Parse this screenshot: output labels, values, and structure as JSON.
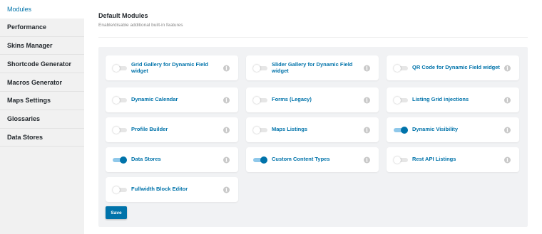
{
  "sidebar": {
    "items": [
      {
        "label": "Modules",
        "active": true
      },
      {
        "label": "Performance",
        "active": false
      },
      {
        "label": "Skins Manager",
        "active": false
      },
      {
        "label": "Shortcode Generator",
        "active": false
      },
      {
        "label": "Macros Generator",
        "active": false
      },
      {
        "label": "Maps Settings",
        "active": false
      },
      {
        "label": "Glossaries",
        "active": false
      },
      {
        "label": "Data Stores",
        "active": false
      }
    ]
  },
  "main": {
    "title": "Default Modules",
    "subtitle": "Enable/disable additional built-in features",
    "modules": [
      {
        "label": "Grid Gallery for Dynamic Field widget",
        "enabled": false,
        "info_icon": "info-icon"
      },
      {
        "label": "Slider Gallery for Dynamic Field widget",
        "enabled": false,
        "info_icon": "info-icon"
      },
      {
        "label": "QR Code for Dynamic Field widget",
        "enabled": false,
        "info_icon": "info-icon"
      },
      {
        "label": "Dynamic Calendar",
        "enabled": false,
        "info_icon": "info-icon"
      },
      {
        "label": "Forms (Legacy)",
        "enabled": false,
        "info_icon": "info-icon"
      },
      {
        "label": "Listing Grid injections",
        "enabled": false,
        "info_icon": "info-icon"
      },
      {
        "label": "Profile Builder",
        "enabled": false,
        "info_icon": "info-icon"
      },
      {
        "label": "Maps Listings",
        "enabled": false,
        "info_icon": "info-icon"
      },
      {
        "label": "Dynamic Visibility",
        "enabled": true,
        "info_icon": "info-icon"
      },
      {
        "label": "Data Stores",
        "enabled": true,
        "info_icon": "info-icon"
      },
      {
        "label": "Custom Content Types",
        "enabled": true,
        "info_icon": "info-icon"
      },
      {
        "label": "Rest API Listings",
        "enabled": false,
        "info_icon": "info-icon"
      },
      {
        "label": "Fullwidth Block Editor",
        "enabled": false,
        "info_icon": "info-icon"
      }
    ],
    "info_glyph": "i",
    "save_label": "Save"
  },
  "colors": {
    "accent": "#0073aa",
    "toggle_on_track": "#8fc8ea",
    "toggle_off_track": "#e6e6e6",
    "panel_bg": "#f1f2f4",
    "sidebar_bg": "#f1f1f1"
  }
}
